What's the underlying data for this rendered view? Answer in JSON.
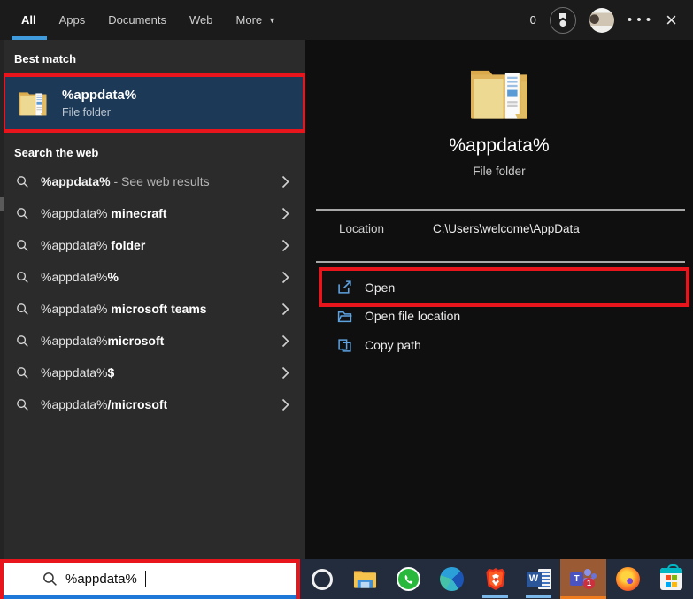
{
  "topbar": {
    "tabs": [
      {
        "label": "All",
        "active": true
      },
      {
        "label": "Apps",
        "active": false
      },
      {
        "label": "Documents",
        "active": false
      },
      {
        "label": "Web",
        "active": false
      },
      {
        "label": "More",
        "active": false,
        "has_dropdown": true
      }
    ],
    "rewards_count": "0"
  },
  "left_panel": {
    "best_match_header": "Best match",
    "best_match": {
      "title": "%appdata%",
      "subtitle": "File folder"
    },
    "web_header": "Search the web",
    "suggestions": [
      {
        "query": "%appdata%",
        "suffix": " - See web results"
      },
      {
        "query": "%appdata%",
        "suffix": " minecraft"
      },
      {
        "query": "%appdata%",
        "suffix": " folder"
      },
      {
        "query": "%appdata%",
        "suffix": "%"
      },
      {
        "query": "%appdata%",
        "suffix": " microsoft teams"
      },
      {
        "query": "%appdata%",
        "suffix": "microsoft"
      },
      {
        "query": "%appdata%",
        "suffix": "$"
      },
      {
        "query": "%appdata%",
        "suffix": "/microsoft"
      }
    ]
  },
  "preview_panel": {
    "title": "%appdata%",
    "subtitle": "File folder",
    "location_label": "Location",
    "location_value": "C:\\Users\\welcome\\AppData",
    "actions": [
      {
        "label": "Open",
        "icon": "open-external-icon"
      },
      {
        "label": "Open file location",
        "icon": "folder-outline-icon"
      },
      {
        "label": "Copy path",
        "icon": "copy-icon"
      }
    ]
  },
  "search_box": {
    "value": "%appdata%"
  },
  "taskbar": {
    "teams_badge": "1",
    "icons": [
      "cortana",
      "file-explorer",
      "whatsapp",
      "edge",
      "brave",
      "word",
      "teams",
      "firefox",
      "microsoft-store"
    ],
    "running": [
      "brave",
      "word",
      "teams"
    ],
    "active": "teams"
  },
  "colors": {
    "annotation_red": "#e8151d",
    "selection_blue": "#1c3a57",
    "tab_accent_blue": "#3f9bdc",
    "search_focus_blue": "#1e78d7",
    "action_icon_blue": "#5ea2e0",
    "taskbar_bg": "#232c3d",
    "teams_tile_bg": "#9a5a33",
    "teams_active_strip": "#ef7d1f"
  }
}
